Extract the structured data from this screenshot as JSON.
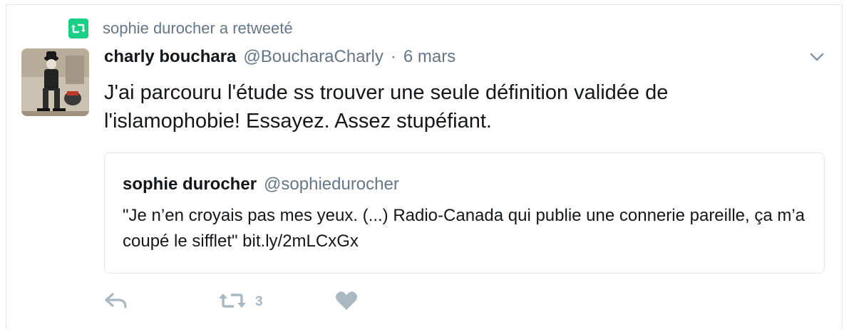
{
  "retweet_context": {
    "icon": "retweet-icon",
    "text": "sophie durocher a retweeté",
    "accent": "#19cf86"
  },
  "tweet": {
    "author_name": "charly bouchara",
    "author_handle": "@BoucharaCharly",
    "separator": "·",
    "time": "6 mars",
    "text": "J'ai parcouru l'étude ss trouver une seule définition validée de l'islamophobie! Essayez. Assez stupéfiant.",
    "menu_icon": "chevron-down-icon"
  },
  "quoted_tweet": {
    "author_name": "sophie durocher",
    "author_handle": "@sophiedurocher",
    "text": "\"Je n’en croyais pas mes yeux. (...) Radio-Canada qui publie une connerie pareille, ça m’a coupé le sifflet\" bit.ly/2mLCxGx"
  },
  "actions": {
    "reply_icon": "reply-icon",
    "retweet_icon": "retweet-icon",
    "retweet_count": "3",
    "like_icon": "heart-icon",
    "icon_color": "#aab8c2"
  }
}
